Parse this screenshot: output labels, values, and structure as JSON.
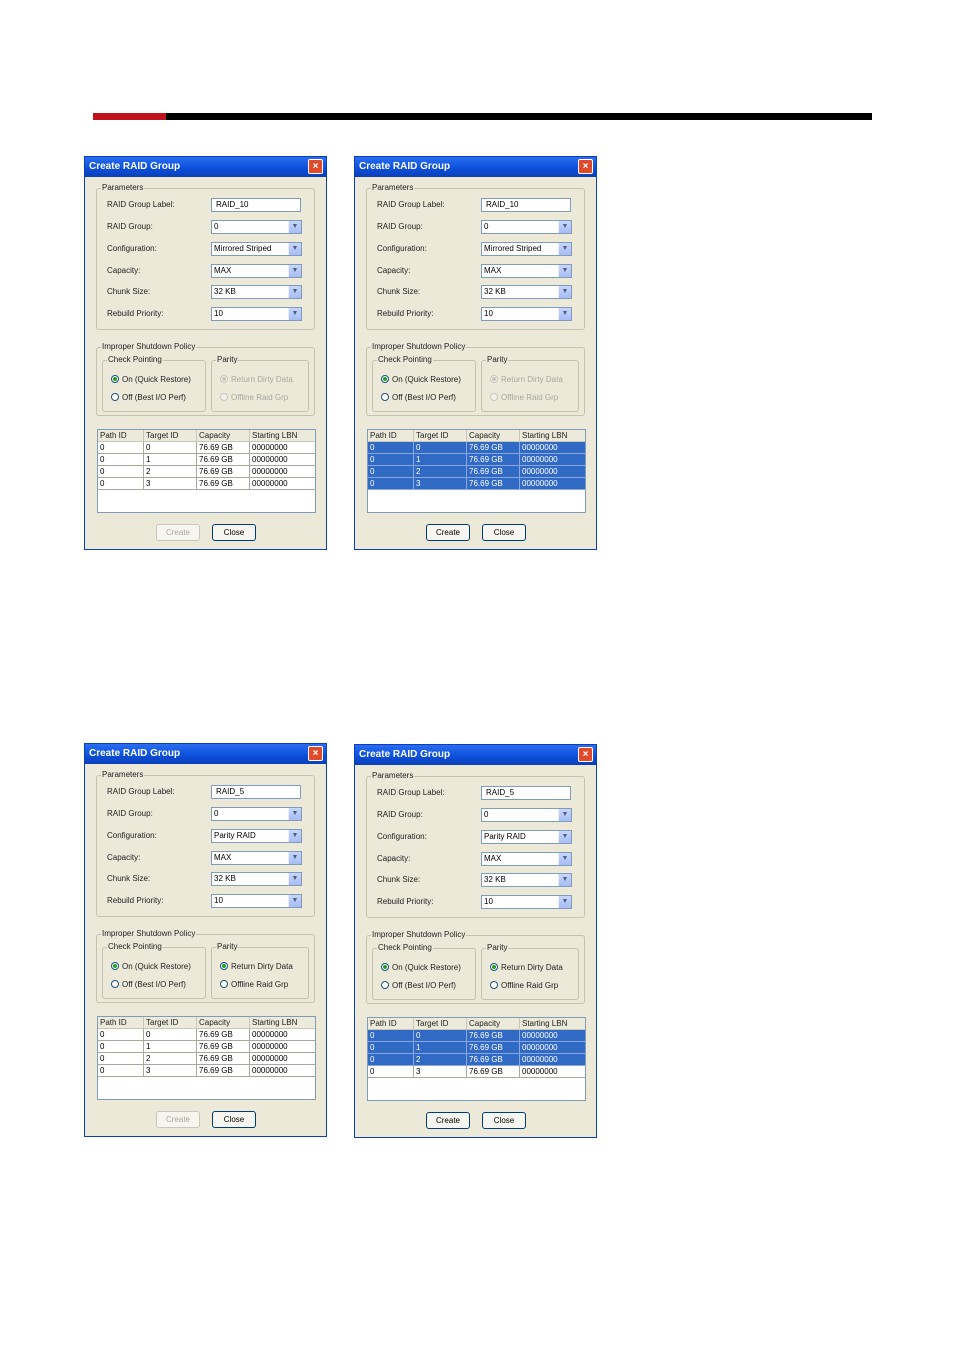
{
  "dialog_common": {
    "title": "Create RAID Group",
    "close_glyph": "×",
    "parameters_label": "Parameters",
    "field_labels": [
      "RAID Group Label:",
      "RAID Group:",
      "Configuration:",
      "Capacity:",
      "Chunk Size:",
      "Rebuild Priority:"
    ],
    "policy_label": "Improper Shutdown Policy",
    "checkpointing_label": "Check Pointing",
    "checkpointing_options": [
      "On (Quick Restore)",
      "Off (Best I/O Perf)"
    ],
    "parity_label": "Parity",
    "parity_options": [
      "Return Dirty Data",
      "Offline Raid Grp"
    ],
    "table_headers": [
      "Path ID",
      "Target ID",
      "Capacity",
      "Starting LBN"
    ],
    "table_rows": [
      [
        "0",
        "0",
        "76.69 GB",
        "00000000"
      ],
      [
        "0",
        "1",
        "76.69 GB",
        "00000000"
      ],
      [
        "0",
        "2",
        "76.69 GB",
        "00000000"
      ],
      [
        "0",
        "3",
        "76.69 GB",
        "00000000"
      ]
    ],
    "create_label": "Create",
    "close_label": "Close"
  },
  "dialogs": [
    {
      "values": [
        "RAID_10",
        "0",
        "Mirrored Striped",
        "MAX",
        "32 KB",
        "10"
      ],
      "checkpointing_selected": 0,
      "parity_enabled": false,
      "parity_selected": 0,
      "selected_rows": [],
      "create_enabled": false
    },
    {
      "values": [
        "RAID_10",
        "0",
        "Mirrored Striped",
        "MAX",
        "32 KB",
        "10"
      ],
      "checkpointing_selected": 0,
      "parity_enabled": false,
      "parity_selected": 0,
      "selected_rows": [
        0,
        1,
        2,
        3
      ],
      "create_enabled": true
    },
    {
      "values": [
        "RAID_5",
        "0",
        "Parity RAID",
        "MAX",
        "32 KB",
        "10"
      ],
      "checkpointing_selected": 0,
      "parity_enabled": true,
      "parity_selected": 0,
      "selected_rows": [],
      "create_enabled": false
    },
    {
      "values": [
        "RAID_5",
        "0",
        "Parity RAID",
        "MAX",
        "32 KB",
        "10"
      ],
      "checkpointing_selected": 0,
      "parity_enabled": true,
      "parity_selected": 0,
      "selected_rows": [
        0,
        1,
        2
      ],
      "create_enabled": true
    }
  ],
  "colors": {
    "header_rule_red": "#c0121c",
    "header_rule_black": "#000000",
    "selection": "#316ac5"
  }
}
